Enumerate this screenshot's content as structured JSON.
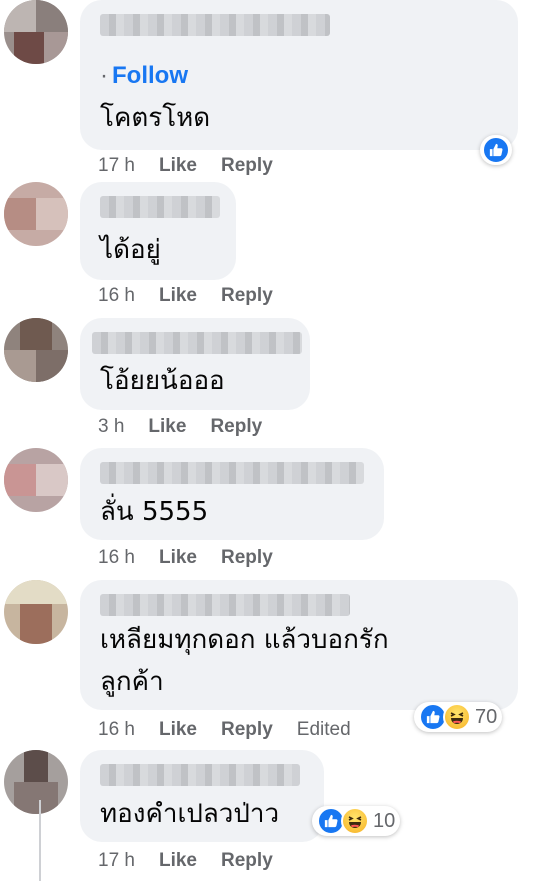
{
  "comments": [
    {
      "follow_label": "Follow",
      "follow_dot": "·",
      "text": [
        "โคตรโหด"
      ],
      "time": "17 h",
      "like": "Like",
      "reply": "Reply"
    },
    {
      "text": [
        "ได้อยู่"
      ],
      "time": "16 h",
      "like": "Like",
      "reply": "Reply"
    },
    {
      "text": [
        "โอ้ยยน้อออ"
      ],
      "time": "3 h",
      "like": "Like",
      "reply": "Reply"
    },
    {
      "text": [
        "ลั่น 5555"
      ],
      "time": "16 h",
      "like": "Like",
      "reply": "Reply"
    },
    {
      "text": [
        "เหลียมทุกดอก แล้วบอกรัก",
        "ลูกค้า"
      ],
      "time": "16 h",
      "like": "Like",
      "reply": "Reply",
      "edited": "Edited",
      "reaction_count": "70"
    },
    {
      "text": [
        "ทองคำเปลวป่าว"
      ],
      "time": "17 h",
      "like": "Like",
      "reply": "Reply",
      "reaction_count": "10"
    }
  ],
  "colors": {
    "accent": "#1877f2",
    "bubble": "#f0f2f5",
    "meta": "#65676b"
  },
  "icons": [
    "like-reaction-icon",
    "haha-reaction-icon",
    "thumbs-up-icon"
  ]
}
